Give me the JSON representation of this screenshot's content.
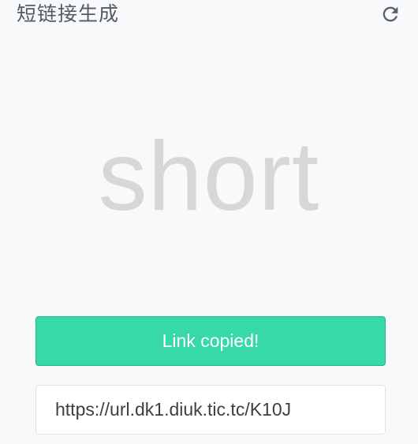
{
  "header": {
    "title": "短链接生成",
    "refresh_icon": "refresh-icon"
  },
  "hero": {
    "word": "short"
  },
  "copy_button": {
    "label": "Link copied!"
  },
  "url_field": {
    "value": "https://url.dk1.diuk.tic.tc/K10J"
  },
  "colors": {
    "background": "#f8f9fb",
    "accent_green": "#37d9a6",
    "hero_text": "#d6d7d9",
    "title_text": "#555b61"
  }
}
